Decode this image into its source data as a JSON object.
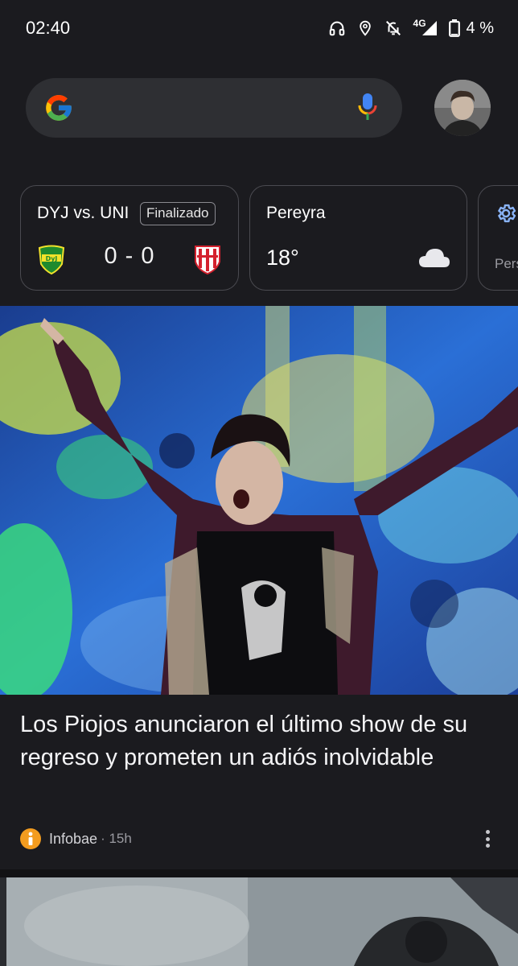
{
  "status_bar": {
    "time": "02:40",
    "network": "4G",
    "battery": "4 %",
    "icons": [
      "headphones-icon",
      "location-icon",
      "notifications-off-icon",
      "signal-icon",
      "battery-icon"
    ]
  },
  "search": {
    "placeholder": "",
    "logo_colors": [
      "#4285F4",
      "#EA4335",
      "#FBBC05",
      "#34A853"
    ]
  },
  "cards": {
    "score": {
      "title": "DYJ vs. UNI",
      "status": "Finalizado",
      "home_badge": "DyJ",
      "score": "0 - 0"
    },
    "weather": {
      "location": "Pereyra",
      "temperature": "18°"
    },
    "settings": {
      "label": "Pers"
    }
  },
  "article": {
    "title": "Los Piojos anunciaron el último show de su regreso y prometen un adiós inolvidable",
    "source": "Infobae",
    "time": "· 15h"
  },
  "colors": {
    "background": "#1b1b1f",
    "card_border": "#4a4a50",
    "accent_blue": "#8ab4f8",
    "source_orange": "#f39c1f"
  }
}
